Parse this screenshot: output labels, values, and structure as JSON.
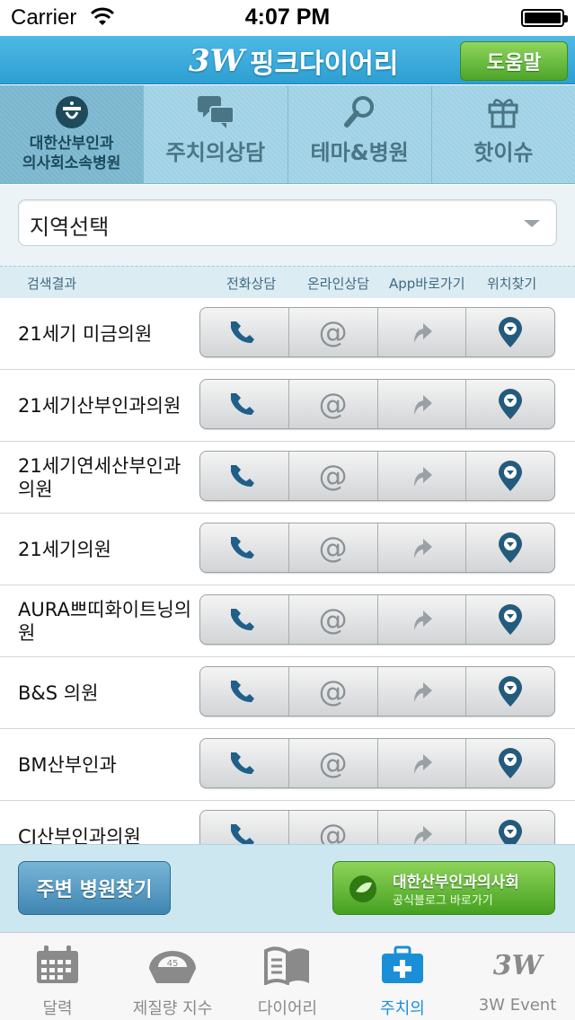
{
  "status_bar": {
    "carrier": "Carrier",
    "time": "4:07 PM"
  },
  "header": {
    "logo_mark": "3W",
    "title": "핑크다이어리",
    "help_label": "도움말"
  },
  "tabs": [
    {
      "label_line1": "대한산부인과",
      "label_line2": "의사회소속병원",
      "icon": "doctor-association-icon",
      "active": true
    },
    {
      "label": "주치의상담",
      "icon": "chat-bubbles-icon",
      "active": false
    },
    {
      "label": "테마&병원",
      "icon": "magnifier-icon",
      "active": false
    },
    {
      "label": "핫이슈",
      "icon": "gift-box-icon",
      "active": false
    }
  ],
  "region_select": {
    "value": "지역선택"
  },
  "columns": {
    "result": "검색결과",
    "phone": "전화상담",
    "online": "온라인상담",
    "app": "App바로가기",
    "location": "위치찾기"
  },
  "hospitals": [
    {
      "name": "21세기 미금의원"
    },
    {
      "name": "21세기산부인과의원"
    },
    {
      "name": "21세기연세산부인과의원"
    },
    {
      "name": "21세기의원"
    },
    {
      "name": "AURA쁘띠화이트닝의원"
    },
    {
      "name": "B&S 의원"
    },
    {
      "name": "BM산부인과"
    },
    {
      "name": "CJ산부인과의원"
    }
  ],
  "bottom_actions": {
    "nearby_label": "주변 병원찾기",
    "blog_title": "대한산부인과의사회",
    "blog_subtitle": "공식블로그 바로가기"
  },
  "tabbar": [
    {
      "label": "달력",
      "icon": "calendar-icon",
      "active": false
    },
    {
      "label": "제질량 지수",
      "icon": "scale-icon",
      "active": false
    },
    {
      "label": "다이어리",
      "icon": "diary-book-icon",
      "active": false
    },
    {
      "label": "주치의",
      "icon": "medical-kit-icon",
      "active": true
    },
    {
      "label": "3W Event",
      "icon": "3w-event-icon",
      "active": false
    }
  ],
  "colors": {
    "header_blue": "#2e9fd3",
    "green_button": "#4da52a",
    "phone_icon": "#1f5f8a",
    "location_pin": "#245b7d",
    "tabbar_active": "#1a8fd8"
  }
}
